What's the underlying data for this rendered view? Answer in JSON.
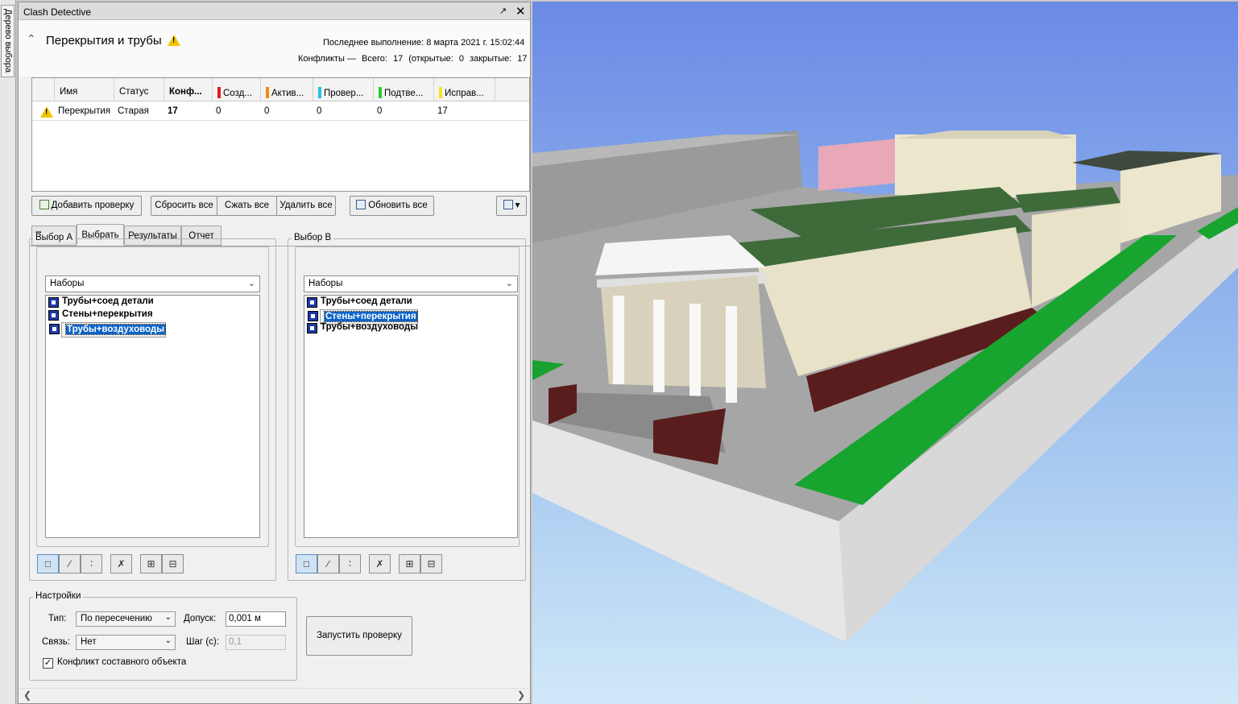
{
  "side_tab": {
    "label": "Дерево выбора"
  },
  "window": {
    "title": "Clash Detective",
    "pin_label": "↗",
    "close_label": "✕"
  },
  "test": {
    "collapse_label": "^",
    "name": "Перекрытия и трубы",
    "last_run_label": "Последнее выполнение:",
    "last_run_value": "8 марта 2021 г. 15:02:44",
    "conflicts_label": "Конфликты —",
    "total_label": "Всего:",
    "total_value": "17",
    "open_label": "(открытые:",
    "open_value": "0",
    "closed_label": "закрытые:",
    "closed_value": "17"
  },
  "grid": {
    "columns": [
      "Имя",
      "Статус",
      "Конф...",
      "Созд...",
      "Актив...",
      "Провер...",
      "Подтве...",
      "Исправ..."
    ],
    "status_colors": {
      "new": "#e21d1d",
      "active": "#f28a1c",
      "reviewed": "#27c1e6",
      "approved": "#2fcb2f",
      "resolved": "#f5e322"
    },
    "rows": [
      {
        "name": "Перекрытия",
        "status": "Старая",
        "conflicts": "17",
        "new": "0",
        "active": "0",
        "reviewed": "0",
        "approved": "0",
        "resolved": "17"
      }
    ]
  },
  "toolbar": {
    "add_test": "Добавить проверку",
    "reset_all": "Сбросить все",
    "compact_all": "Сжать все",
    "delete_all": "Удалить все",
    "update_all": "Обновить все"
  },
  "tabs": [
    "Правила",
    "Выбрать",
    "Результаты",
    "Отчет"
  ],
  "active_tab": "Выбрать",
  "selection_a": {
    "label": "Выбор А",
    "dropdown": "Наборы",
    "items": [
      {
        "label": "Трубы+соед детали",
        "selected": false
      },
      {
        "label": "Стены+перекрытия",
        "selected": false
      },
      {
        "label": "Трубы+воздуховоды",
        "selected": true
      }
    ]
  },
  "selection_b": {
    "label": "Выбор В",
    "dropdown": "Наборы",
    "items": [
      {
        "label": "Трубы+соед детали",
        "selected": false
      },
      {
        "label": "Стены+перекрытия",
        "selected": true
      },
      {
        "label": "Трубы+воздуховоды",
        "selected": false
      }
    ]
  },
  "settings": {
    "label": "Настройки",
    "type_label": "Тип:",
    "type_value": "По пересечению",
    "tolerance_label": "Допуск:",
    "tolerance_value": "0,001 м",
    "link_label": "Связь:",
    "link_value": "Нет",
    "step_label": "Шаг (с):",
    "step_value": "0,1",
    "composite_label": "Конфликт составного объекта",
    "composite_checked": true,
    "run_button": "Запустить проверку"
  }
}
